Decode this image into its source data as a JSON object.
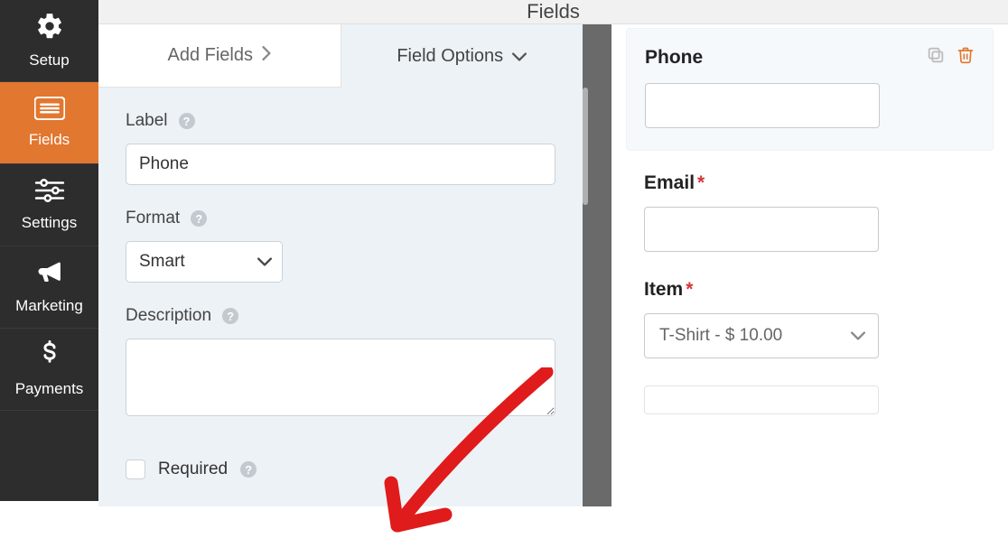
{
  "sidebar": {
    "items": [
      {
        "label": "Setup"
      },
      {
        "label": "Fields"
      },
      {
        "label": "Settings"
      },
      {
        "label": "Marketing"
      },
      {
        "label": "Payments"
      }
    ]
  },
  "topbar": {
    "title": "Fields"
  },
  "tabs": {
    "add_fields": "Add Fields",
    "field_options": "Field Options"
  },
  "options": {
    "label_heading": "Label",
    "label_value": "Phone",
    "format_heading": "Format",
    "format_value": "Smart",
    "description_heading": "Description",
    "description_value": "",
    "required_label": "Required"
  },
  "preview": {
    "phone": {
      "label": "Phone"
    },
    "email": {
      "label": "Email"
    },
    "item": {
      "label": "Item",
      "select_value": "T-Shirt - $ 10.00"
    }
  }
}
